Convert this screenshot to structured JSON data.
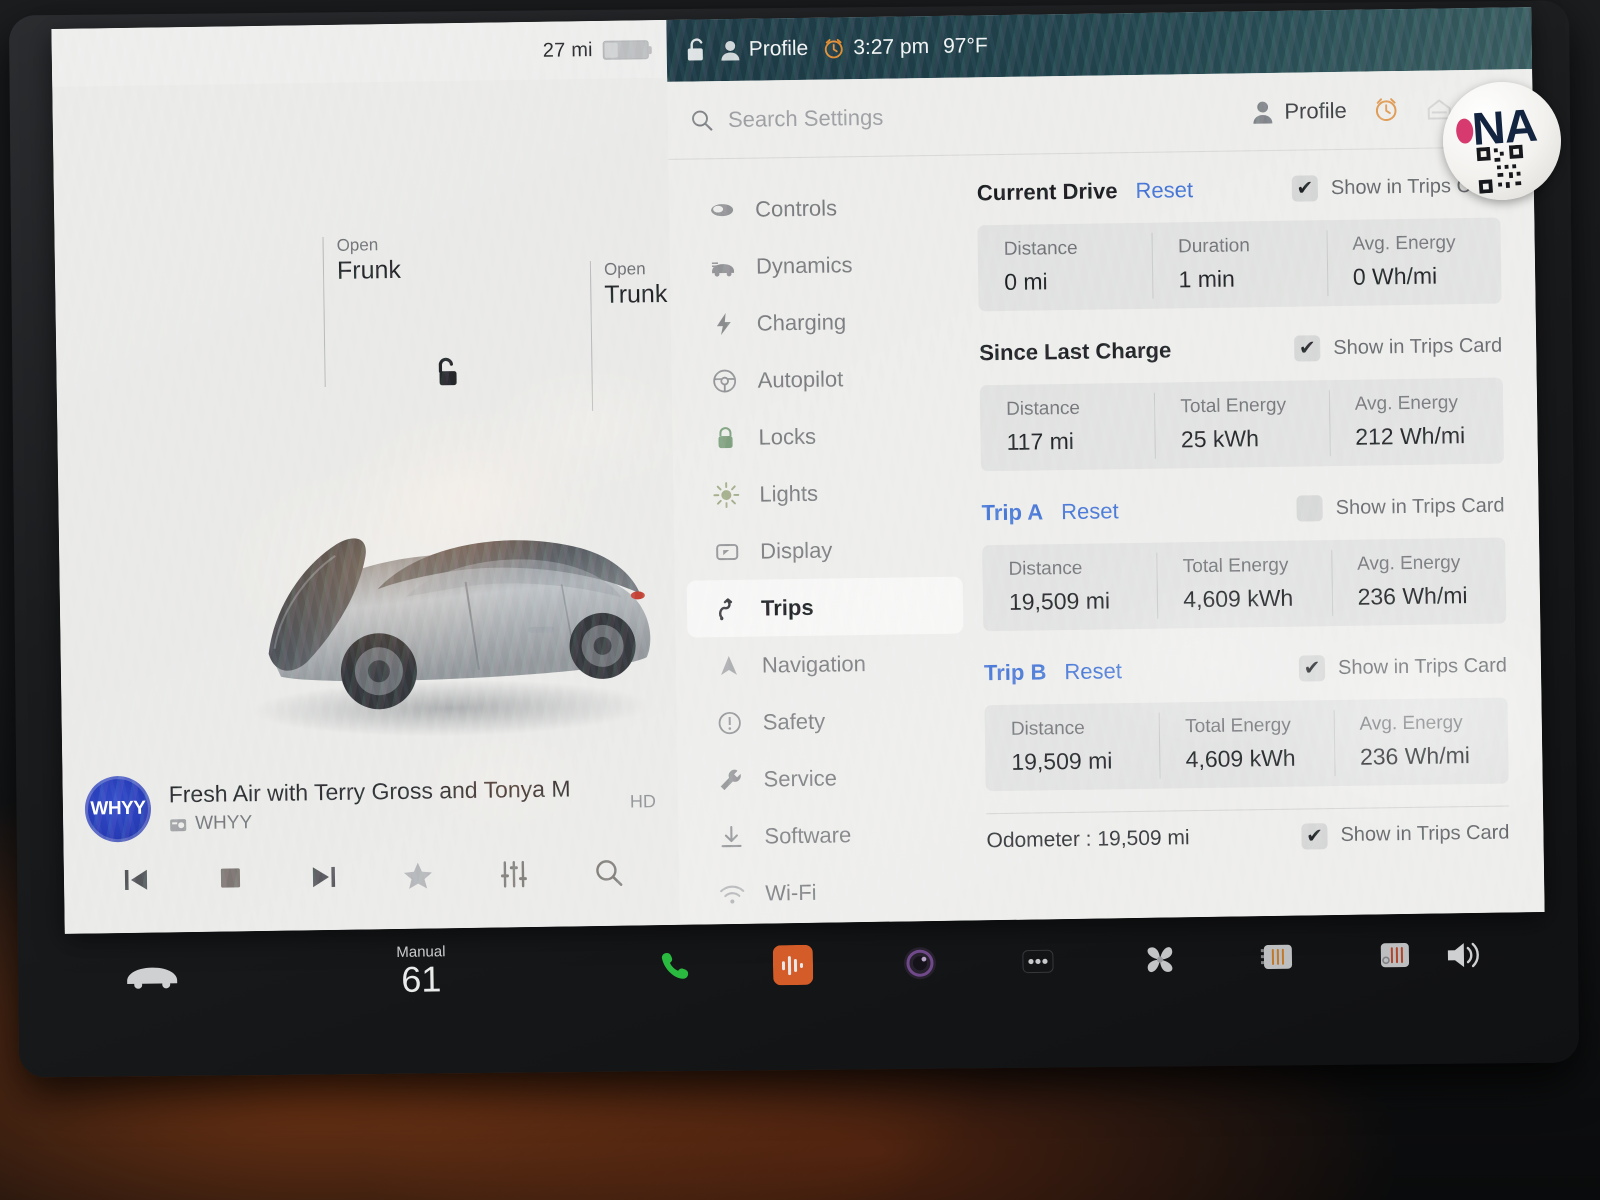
{
  "status_bar": {
    "range": "27 mi",
    "lock_state_icon": "unlocked-padlock-icon",
    "profile_label": "Profile",
    "time": "3:27 pm",
    "temperature": "97°F",
    "auto_headlight_icon": "auto-headlight-icon"
  },
  "car_panel": {
    "frunk": {
      "action": "Open",
      "name": "Frunk"
    },
    "trunk": {
      "action": "Open",
      "name": "Trunk"
    },
    "unlock_icon": "unlock-icon",
    "vehicle_image": "tesla-model-y-3d-render"
  },
  "media": {
    "station_logo": "WHYY",
    "title": "Fresh Air with Terry Gross and Tonya M",
    "source": "WHYY",
    "source_icon": "radio-icon",
    "hd_badge": "HD",
    "controls": [
      {
        "name": "previous-track-button",
        "glyph": "prev"
      },
      {
        "name": "stop-button",
        "glyph": "stop"
      },
      {
        "name": "next-track-button",
        "glyph": "next"
      },
      {
        "name": "favorite-button",
        "glyph": "star"
      },
      {
        "name": "equalizer-button",
        "glyph": "sliders"
      },
      {
        "name": "search-media-button",
        "glyph": "search"
      }
    ]
  },
  "settings": {
    "search": {
      "placeholder": "Search Settings",
      "value": ""
    },
    "header": {
      "profile_label": "Profile",
      "alarm_icon": "alarm-clock-icon",
      "garage_icon": "garage-door-icon",
      "bell_icon": "notification-bell-icon"
    },
    "sidebar": [
      {
        "label": "Controls",
        "icon": "car-controls-icon",
        "active": false
      },
      {
        "label": "Dynamics",
        "icon": "car-dynamics-icon",
        "active": false
      },
      {
        "label": "Charging",
        "icon": "charging-bolt-icon",
        "active": false
      },
      {
        "label": "Autopilot",
        "icon": "steering-wheel-icon",
        "active": false
      },
      {
        "label": "Locks",
        "icon": "padlock-icon",
        "active": false
      },
      {
        "label": "Lights",
        "icon": "lights-icon",
        "active": false
      },
      {
        "label": "Display",
        "icon": "display-icon",
        "active": false
      },
      {
        "label": "Trips",
        "icon": "winding-road-icon",
        "active": true
      },
      {
        "label": "Navigation",
        "icon": "navigation-arrow-icon",
        "active": false
      },
      {
        "label": "Safety",
        "icon": "exclamation-circle-icon",
        "active": false
      },
      {
        "label": "Service",
        "icon": "wrench-icon",
        "active": false
      },
      {
        "label": "Software",
        "icon": "download-icon",
        "active": false
      },
      {
        "label": "Wi-Fi",
        "icon": "wifi-icon",
        "active": false
      }
    ],
    "show_in_trips_card_label": "Show in Trips Card",
    "reset_label": "Reset",
    "trips": [
      {
        "name": "Current Drive",
        "name_is_link": false,
        "has_reset": true,
        "show_in_trips_card": true,
        "stats": [
          {
            "label": "Distance",
            "value": "0 mi"
          },
          {
            "label": "Duration",
            "value": "1 min"
          },
          {
            "label": "Avg. Energy",
            "value": "0 Wh/mi"
          }
        ]
      },
      {
        "name": "Since Last Charge",
        "name_is_link": false,
        "has_reset": false,
        "show_in_trips_card": true,
        "stats": [
          {
            "label": "Distance",
            "value": "117 mi"
          },
          {
            "label": "Total Energy",
            "value": "25 kWh"
          },
          {
            "label": "Avg. Energy",
            "value": "212 Wh/mi"
          }
        ]
      },
      {
        "name": "Trip A",
        "name_is_link": true,
        "has_reset": true,
        "show_in_trips_card": false,
        "stats": [
          {
            "label": "Distance",
            "value": "19,509 mi"
          },
          {
            "label": "Total Energy",
            "value": "4,609 kWh"
          },
          {
            "label": "Avg. Energy",
            "value": "236 Wh/mi"
          }
        ]
      },
      {
        "name": "Trip B",
        "name_is_link": true,
        "has_reset": true,
        "show_in_trips_card": true,
        "stats": [
          {
            "label": "Distance",
            "value": "19,509 mi"
          },
          {
            "label": "Total Energy",
            "value": "4,609 kWh"
          },
          {
            "label": "Avg. Energy",
            "value": "236 Wh/mi"
          }
        ]
      }
    ],
    "odometer": {
      "text": "Odometer : 19,509 mi",
      "show_in_trips_card": true
    }
  },
  "bottom_bar": {
    "car_icon": "car-icon",
    "climate_mode": "Manual",
    "climate_temp": "61",
    "phone_icon": "phone-icon",
    "media_icon": "media-waveform-icon",
    "camera_icon": "camera-lens-icon",
    "more_icon": "more-dots-icon",
    "fan_icon": "fan-icon",
    "seat_heater_left_icon": "seat-heater-left-icon",
    "seat_heater_right_icon": "seat-heater-right-icon",
    "volume_icon": "volume-icon"
  },
  "sticker": {
    "text": "NA",
    "qr_icon": "qr-code-icon"
  },
  "colors": {
    "accent_blue": "#3d6fd4",
    "screen_bg": "#ececea",
    "status_bar_dark": "#1c3c46",
    "orange_accent": "#d4812b"
  }
}
